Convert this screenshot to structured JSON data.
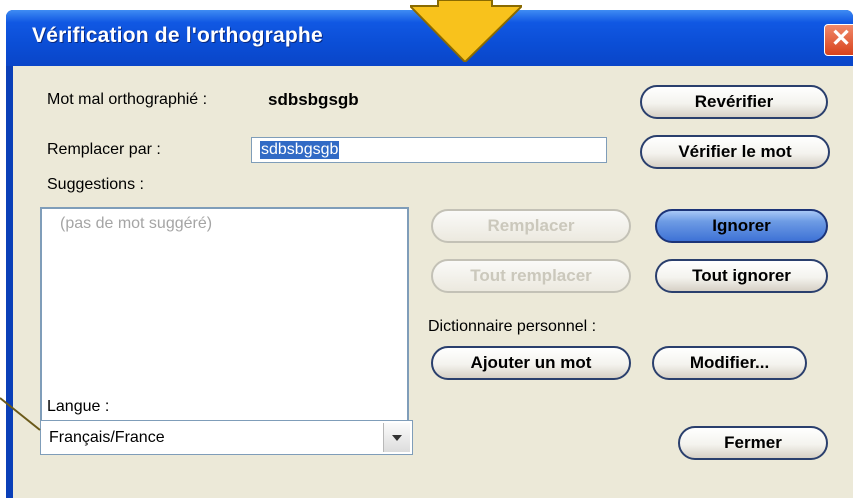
{
  "window": {
    "title": "Vérification de l'orthographe"
  },
  "fields": {
    "misspelled_label": "Mot mal orthographié :",
    "misspelled_value": "sdbsbgsgb",
    "replace_label": "Remplacer par :",
    "replace_value": "sdbsbgsgb",
    "suggestions_label": "Suggestions :",
    "suggestions_empty": "(pas de mot suggéré)",
    "dictionary_label": "Dictionnaire personnel :",
    "language_label": "Langue :",
    "language_value": "Français/France"
  },
  "buttons": {
    "recheck": "Revérifier",
    "check_word": "Vérifier le mot",
    "replace": "Remplacer",
    "replace_all": "Tout remplacer",
    "ignore": "Ignorer",
    "ignore_all": "Tout ignorer",
    "add_word": "Ajouter un mot",
    "modify": "Modifier...",
    "close": "Fermer"
  },
  "icons": {
    "close": "close-icon",
    "dropdown": "chevron-down-icon",
    "pointer_arrow": "yellow-arrow-down-icon",
    "callout_line": "callout-line-icon"
  },
  "colors": {
    "titlebar": "#0b4ed6",
    "client": "#ece9d8",
    "selection": "#316ac5",
    "arrow": "#f8c21c"
  }
}
